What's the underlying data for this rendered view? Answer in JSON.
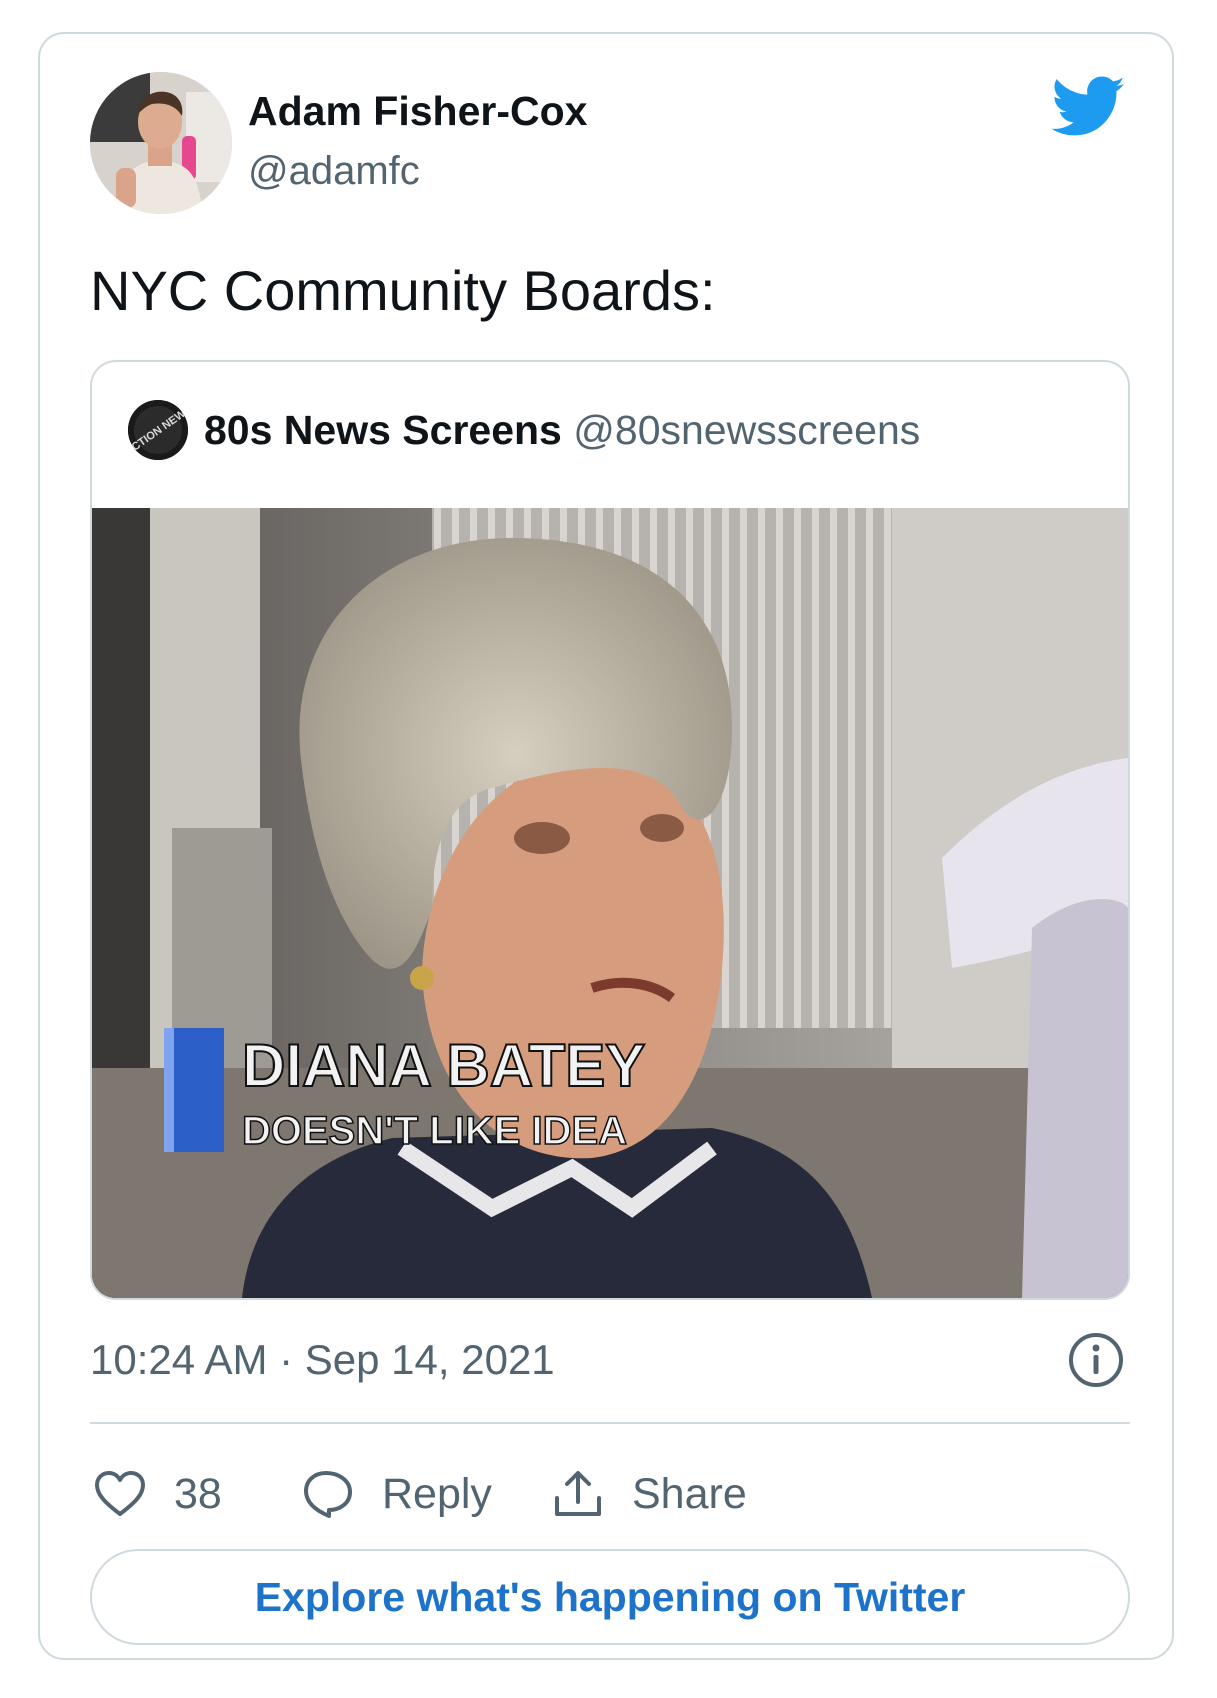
{
  "tweet": {
    "author_name": "Adam Fisher-Cox",
    "author_handle": "@adamfc",
    "text": "NYC Community Boards:",
    "timestamp": "10:24 AM · Sep 14, 2021"
  },
  "quoted_tweet": {
    "author_name": "80s News Screens",
    "author_handle": "@80snewsscreens",
    "avatar_text": "ACTION NEWS",
    "media_caption_name": "DIANA BATEY",
    "media_caption_sub": "DOESN'T LIKE IDEA"
  },
  "actions": {
    "likes_count": "38",
    "reply_label": "Reply",
    "share_label": "Share"
  },
  "explore_label": "Explore what's happening on Twitter",
  "icons": {
    "brand": "twitter-bird-icon",
    "info": "info-icon",
    "like": "heart-icon",
    "reply": "speech-bubble-icon",
    "share": "upload-icon"
  },
  "colors": {
    "twitter_blue": "#1d9bf0",
    "link_blue": "#1d72c9",
    "secondary_text": "#536471",
    "border": "#cfd9de"
  }
}
